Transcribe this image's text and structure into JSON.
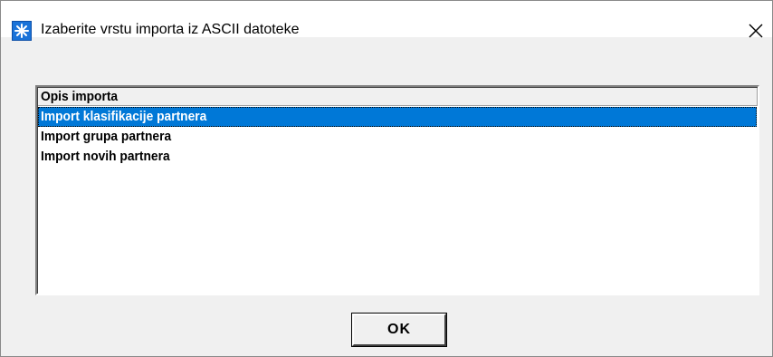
{
  "window": {
    "title": "Izaberite vrstu importa iz ASCII datoteke",
    "app_icon": "asterisk-star-icon",
    "close_icon": "close-icon"
  },
  "list": {
    "column_header": "Opis importa",
    "items": [
      {
        "label": "Import klasifikacije partnera",
        "selected": true
      },
      {
        "label": "Import grupa partnera",
        "selected": false
      },
      {
        "label": "Import novih partnera",
        "selected": false
      }
    ]
  },
  "buttons": {
    "ok_label": "OK"
  },
  "colors": {
    "selection": "#0078d7",
    "dialog_background": "#f0f0f0",
    "list_background": "#ffffff"
  }
}
